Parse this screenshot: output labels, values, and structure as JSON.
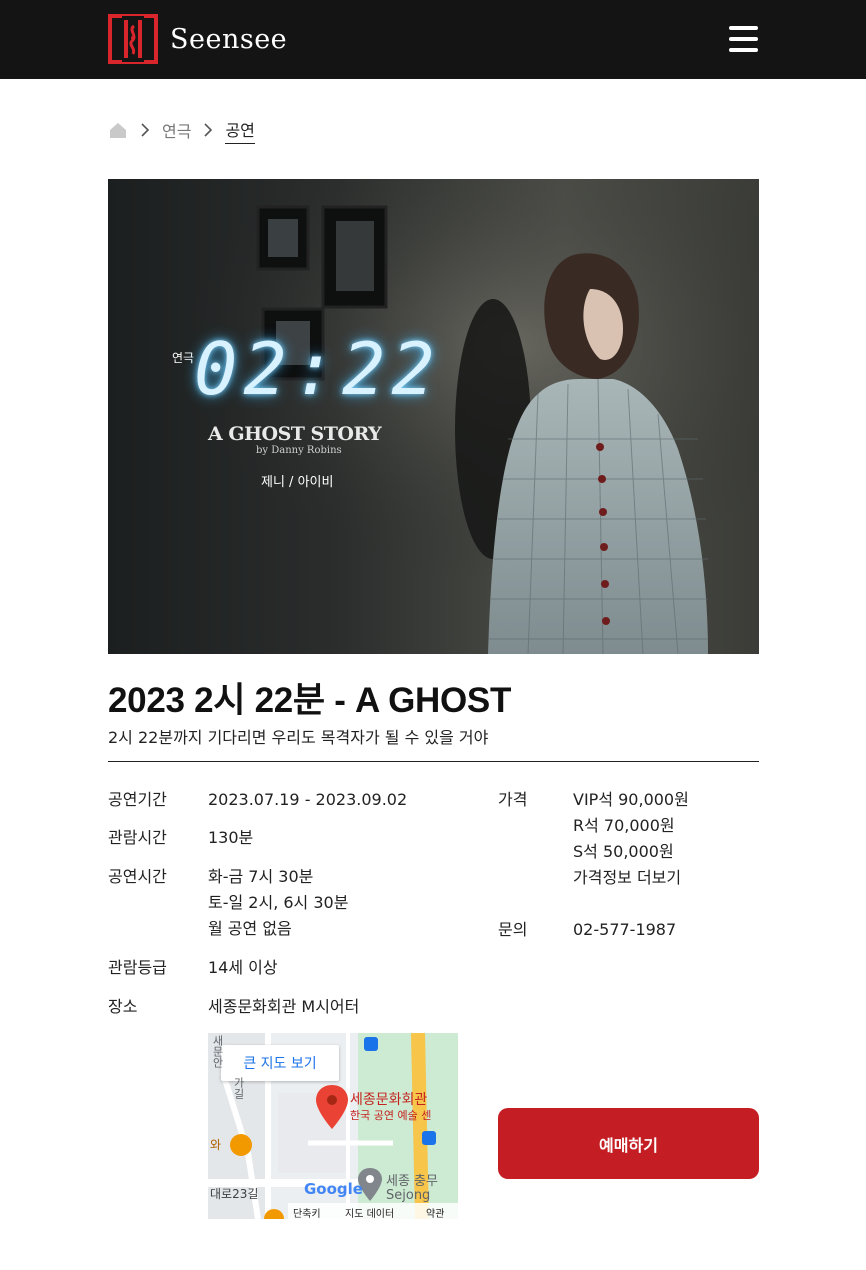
{
  "header": {
    "logo_text": "Seensee",
    "menu_icon": "hamburger-menu-icon"
  },
  "breadcrumb": {
    "home_icon": "home-icon",
    "items": [
      "연극",
      "공연"
    ]
  },
  "poster": {
    "genre": "연극",
    "time": "02:22",
    "subtitle": "A GHOST STORY",
    "byline": "by Danny Robins",
    "cast": "제니 / 아이비"
  },
  "show": {
    "title": "2023 2시 22분 - A GHOST",
    "tagline": "2시 22분까지 기다리면 우리도 목격자가 될 수 있을 거야"
  },
  "info": {
    "period_label": "공연기간",
    "period_value": "2023.07.19 - 2023.09.02",
    "runtime_label": "관람시간",
    "runtime_value": "130분",
    "showtime_label": "공연시간",
    "showtime_lines": [
      "화-금 7시 30분",
      "토-일 2시, 6시 30분",
      "월 공연 없음"
    ],
    "rating_label": "관람등급",
    "rating_value": "14세 이상",
    "venue_label": "장소",
    "venue_value": "세종문화회관 M시어터",
    "price_label": "가격",
    "price_lines": [
      "VIP석 90,000원",
      "R석 70,000원",
      "S석 50,000원"
    ],
    "price_more": "가격정보 더보기",
    "contact_label": "문의",
    "contact_value": "02-577-1987"
  },
  "map": {
    "big_map_button": "큰 지도 보기",
    "place_name": "세종문화회관",
    "place_sub": "한국 공연 예술 센",
    "nearby_name": "세종 충무",
    "nearby_sub": "Sejong",
    "road_label": "대로23길",
    "vertical_label_1": "새문안",
    "vertical_label_2": "가길",
    "food_label": "와",
    "google_logo": "Google",
    "footer_shortcuts": "단축키",
    "footer_data": "지도 데이터",
    "footer_terms": "약관"
  },
  "actions": {
    "book_label": "예매하기"
  },
  "colors": {
    "header_bg": "#141414",
    "brand_red": "#c41e24",
    "map_pin": "#ea4335",
    "link_blue": "#1a73e8"
  }
}
